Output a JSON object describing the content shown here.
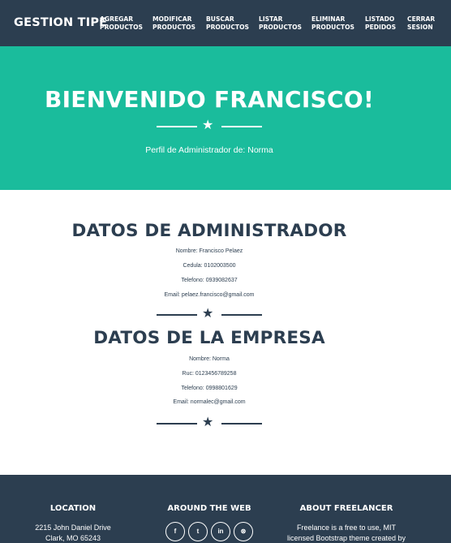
{
  "navbar": {
    "brand": "GESTION TIPE",
    "links": [
      {
        "label": "AGREGAR\nPRODUCTOS"
      },
      {
        "label": "MODIFICAR\nPRODUCTOS"
      },
      {
        "label": "BUSCAR\nPRODUCTOS"
      },
      {
        "label": "LISTAR\nPRODUCTOS"
      },
      {
        "label": "ELIMINAR\nPRODUCTOS"
      },
      {
        "label": "LISTADO\nPEDIDOS"
      },
      {
        "label": "CERRAR\nSESION"
      }
    ]
  },
  "masthead": {
    "title": "BIENVENIDO FRANCISCO!",
    "subtitle": "Perfil de Administrador de: Norma"
  },
  "admin": {
    "title": "DATOS DE ADMINISTRADOR",
    "nombre": "Nombre: Francisco Pelaez",
    "cedula": "Cedula: 0102003500",
    "telefono": "Telefono: 0939082637",
    "email": "Email: pelaez.francisco@gmail.com"
  },
  "empresa": {
    "title": "DATOS DE LA EMPRESA",
    "nombre": "Nombre: Norma",
    "ruc": "Ruc: 0123456789258",
    "telefono": "Telefono: 0998801629",
    "email": "Email: normalec@gmail.com"
  },
  "footer": {
    "location_title": "LOCATION",
    "location_line1": "2215 John Daniel Drive",
    "location_line2": "Clark, MO 65243",
    "web_title": "AROUND THE WEB",
    "social": [
      {
        "icon": "facebook-icon",
        "glyph": "f"
      },
      {
        "icon": "twitter-icon",
        "glyph": "t"
      },
      {
        "icon": "linkedin-icon",
        "glyph": "in"
      },
      {
        "icon": "dribbble-icon",
        "glyph": "⊛"
      }
    ],
    "about_title": "ABOUT FREELANCER",
    "about_line1": "Freelance is a free to use, MIT",
    "about_line2": "licensed Bootstrap theme created by"
  },
  "colors": {
    "primary": "#2c3e50",
    "accent": "#1abc9c",
    "white": "#ffffff"
  }
}
